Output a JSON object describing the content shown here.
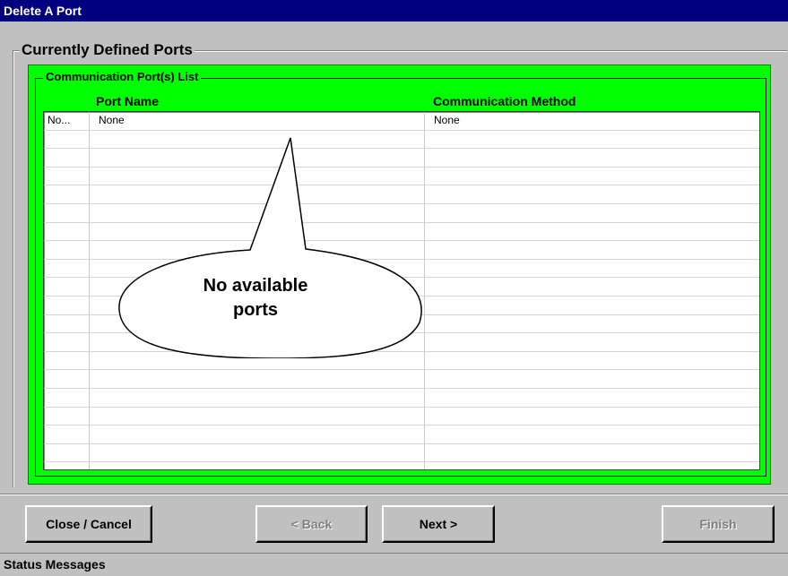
{
  "window": {
    "title": "Delete A Port"
  },
  "group": {
    "label": "Currently Defined Ports"
  },
  "list_group": {
    "label": "Communication Port(s) List"
  },
  "table": {
    "columns": [
      "",
      "Port  Name",
      "Communication Method"
    ],
    "rows": [
      [
        "No...",
        "None",
        "None"
      ]
    ]
  },
  "callout": {
    "line1": "No available",
    "line2": "ports"
  },
  "buttons": {
    "close": "Close / Cancel",
    "back": "< Back",
    "next": "Next >",
    "finish": "Finish"
  },
  "status": {
    "label": "Status Messages"
  }
}
